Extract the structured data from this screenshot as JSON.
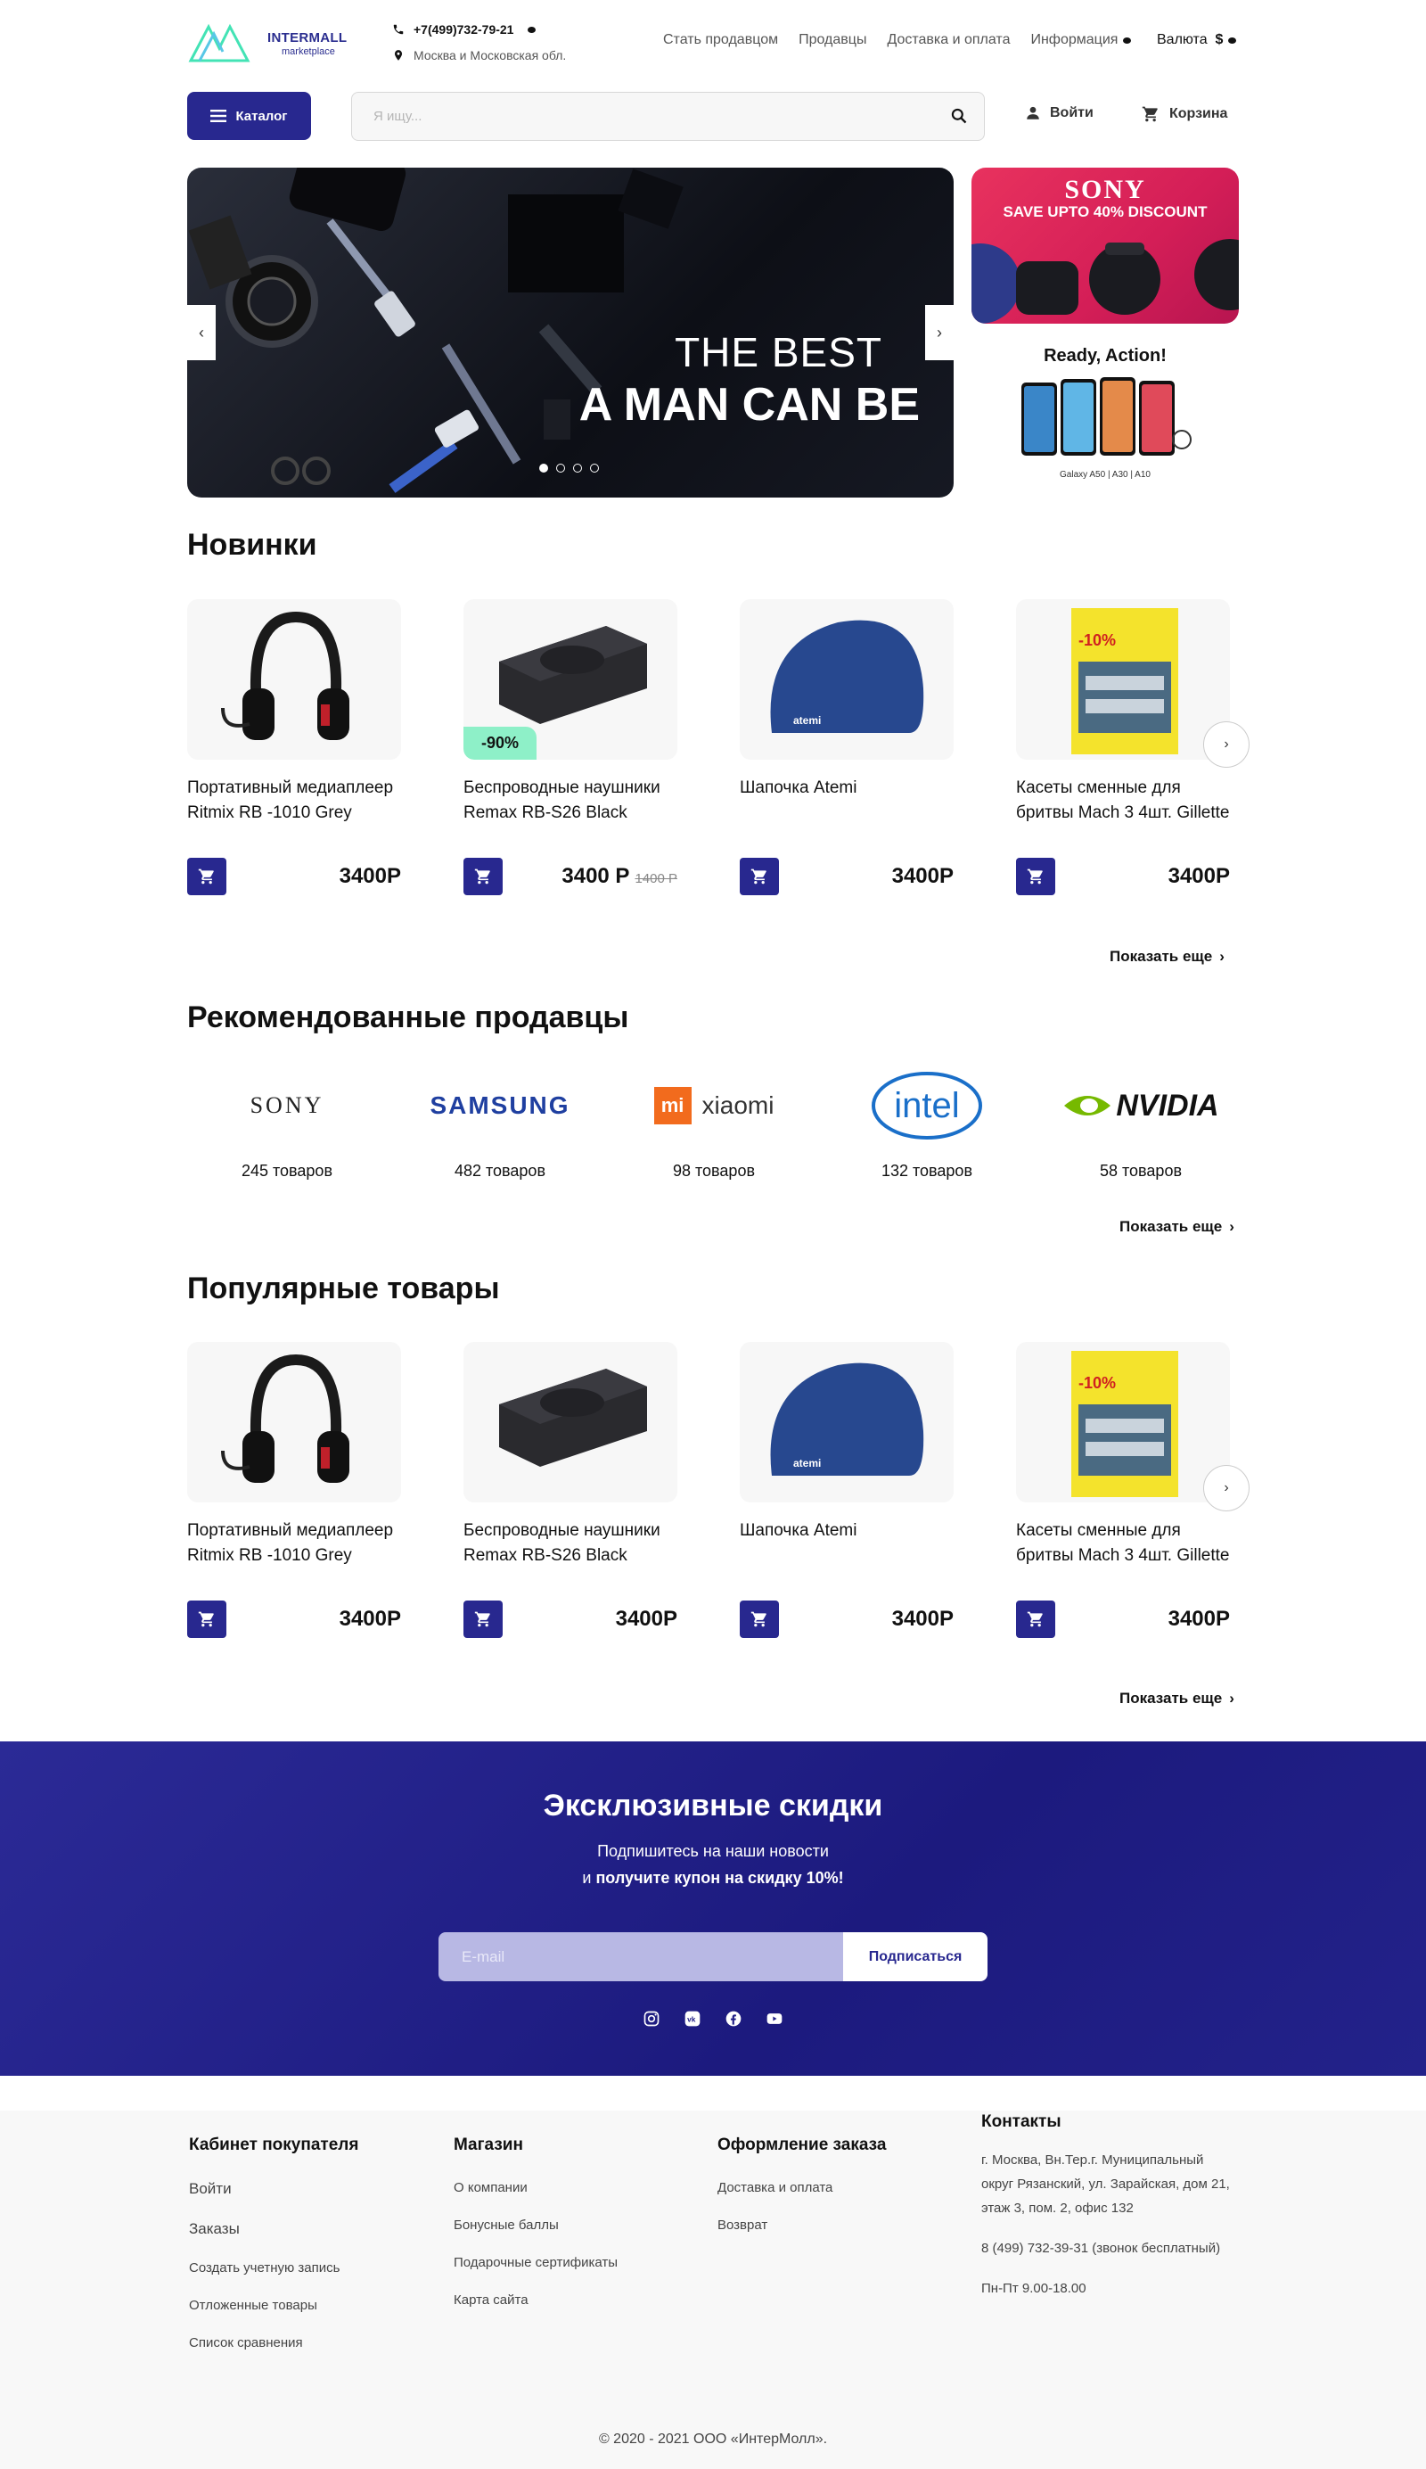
{
  "header": {
    "logo": {
      "brand": "INTERMALL",
      "sub": "marketplace"
    },
    "phone": "+7(499)732-79-21",
    "region": "Москва и Московская обл.",
    "nav": [
      "Стать продавцом",
      "Продавцы",
      "Доставка и оплата",
      "Информация"
    ],
    "currency_label": "Валюта",
    "currency_value": "$",
    "catalog_label": "Каталог",
    "search_placeholder": "Я ищу...",
    "login_label": "Войти",
    "cart_label": "Корзина"
  },
  "banner": {
    "line1": "THE BEST",
    "line2": "A MAN CAN BE",
    "slides": 4,
    "active_slide": 1
  },
  "promo": {
    "sony_brand": "SONY",
    "sony_text": "SAVE UPTO 40% DISCOUNT",
    "galaxy_title": "Ready, Action!",
    "galaxy_sub": "Galaxy A50 | A30 | A10"
  },
  "new_items": {
    "title": "Новинки",
    "products": [
      {
        "name": "Портативный медиаплеер Ritmix RB -1010 Grey",
        "price": "3400Р",
        "old_price": "",
        "badge": "",
        "image": "headphones"
      },
      {
        "name": "Беспроводные наушники Remax RB-S26 Black",
        "price": "3400 Р",
        "old_price": "1400 Р",
        "badge": "-90%",
        "image": "speaker"
      },
      {
        "name": "Шапочка Atemi",
        "price": "3400Р",
        "old_price": "",
        "badge": "",
        "image": "swim-cap"
      },
      {
        "name": "Касеты сменные для бритвы  Mach 3   4шт. Gillette",
        "price": "3400Р",
        "old_price": "",
        "badge": "",
        "image": "razor-pack"
      }
    ],
    "more_label": "Показать еще"
  },
  "sellers": {
    "title": "Рекомендованные продавцы",
    "items": [
      {
        "name": "SONY",
        "count": "245 товаров"
      },
      {
        "name": "SAMSUNG",
        "count": "482 товаров"
      },
      {
        "name": "xiaomi",
        "count": "98 товаров"
      },
      {
        "name": "intel",
        "count": "132 товаров"
      },
      {
        "name": "NVIDIA",
        "count": "58 товаров"
      }
    ],
    "more_label": "Показать еще"
  },
  "popular": {
    "title": "Популярные товары",
    "products": [
      {
        "name": "Портативный медиаплеер Ritmix RB -1010 Grey",
        "price": "3400Р"
      },
      {
        "name": "Беспроводные наушники Remax RB-S26 Black",
        "price": "3400Р"
      },
      {
        "name": "Шапочка Atemi",
        "price": "3400Р"
      },
      {
        "name": "Касеты сменные для бритвы  Mach 3   4шт. Gillette",
        "price": "3400Р"
      }
    ],
    "more_label": "Показать еще"
  },
  "subscribe": {
    "title": "Эксклюзивные скидки",
    "line1": "Подпишитесь на наши новости",
    "line2_prefix": "и ",
    "line2_bold": "получите купон на скидку 10%!",
    "email_placeholder": "E-mail",
    "button": "Подписаться",
    "socials": [
      "instagram-icon",
      "vk-icon",
      "facebook-icon",
      "youtube-icon"
    ]
  },
  "footer": {
    "buyer": {
      "title": "Кабинет покупателя",
      "links": [
        "Войти",
        "Заказы",
        "Создать учетную запись",
        "Отложенные товары",
        "Список сравнения"
      ]
    },
    "shop": {
      "title": "Магазин",
      "links": [
        "О компании",
        "Бонусные баллы",
        "Подарочные сертификаты",
        "Карта сайта"
      ]
    },
    "order": {
      "title": "Оформление заказа",
      "links": [
        "Доставка и оплата",
        "Возврат"
      ]
    },
    "contacts": {
      "title": "Контакты",
      "address": "г. Москва, Вн.Тер.г. Муниципальный округ Рязанский, ул. Зарайская, дом 21, этаж 3, пом. 2, офис 132",
      "phone": "8 (499) 732-39-31 (звонок бесплатный)",
      "hours": "Пн-Пт 9.00-18.00"
    },
    "copyright": "© 2020 - 2021 ООО «ИнтерМолл»."
  },
  "colors": {
    "accent": "#28288f",
    "badge": "#8ef0c8",
    "sony_promo": "#d41e57"
  }
}
